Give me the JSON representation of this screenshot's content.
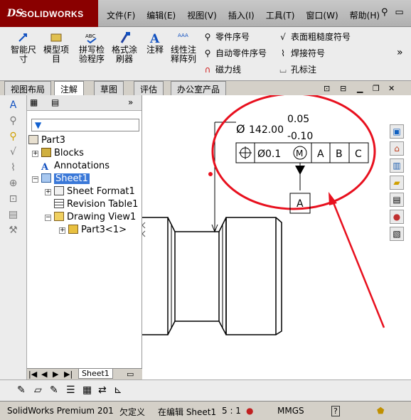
{
  "app": {
    "logo_ds": "DS",
    "logo_name": "SOLIDWORKS"
  },
  "menu": [
    "文件(F)",
    "编辑(E)",
    "视图(V)",
    "插入(I)",
    "工具(T)",
    "窗口(W)",
    "帮助(H)"
  ],
  "ribbon": {
    "smart_dim": "智能尺\n寸",
    "model_items": "模型项\n目",
    "spell_check": "拼写检\n验程序",
    "format_painter": "格式涂\n刷器",
    "note": "注释",
    "linear_note": "线性注\n释阵列",
    "balloon": "零件序号",
    "auto_balloon": "自动零件序号",
    "magnetic_line": "磁力线",
    "surface_finish": "表面粗糙度符号",
    "weld_symbol": "焊接符号",
    "hole_callout": "孔标注"
  },
  "tabs": [
    "视图布局",
    "注解",
    "草图",
    "评估",
    "办公室产品"
  ],
  "tree": {
    "root": "Part3",
    "blocks": "Blocks",
    "annotations": "Annotations",
    "sheet": "Sheet1",
    "sheet_format": "Sheet Format1",
    "revision_table": "Revision Table1",
    "drawing_view": "Drawing View1",
    "part_ref": "Part3<1>"
  },
  "sheet_tab": "Sheet1",
  "drawing": {
    "dim_symbol": "Ø",
    "dim_value": "142.00",
    "tol_upper": "0.05",
    "tol_lower": "-0.10",
    "fcf_tolerance": "Ø0.1",
    "fcf_modifier": "M",
    "datum_a": "A",
    "datum_b": "B",
    "datum_c": "C",
    "datum_label": "A"
  },
  "status": {
    "app_version": "SolidWorks Premium 201",
    "defined": "欠定义",
    "editing": "在编辑 Sheet1",
    "scale": "5 : 1",
    "units": "MMGS"
  },
  "colors": {
    "accent_red": "#e8101e",
    "selection": "#3a78d8",
    "logo": "#8a0000"
  }
}
